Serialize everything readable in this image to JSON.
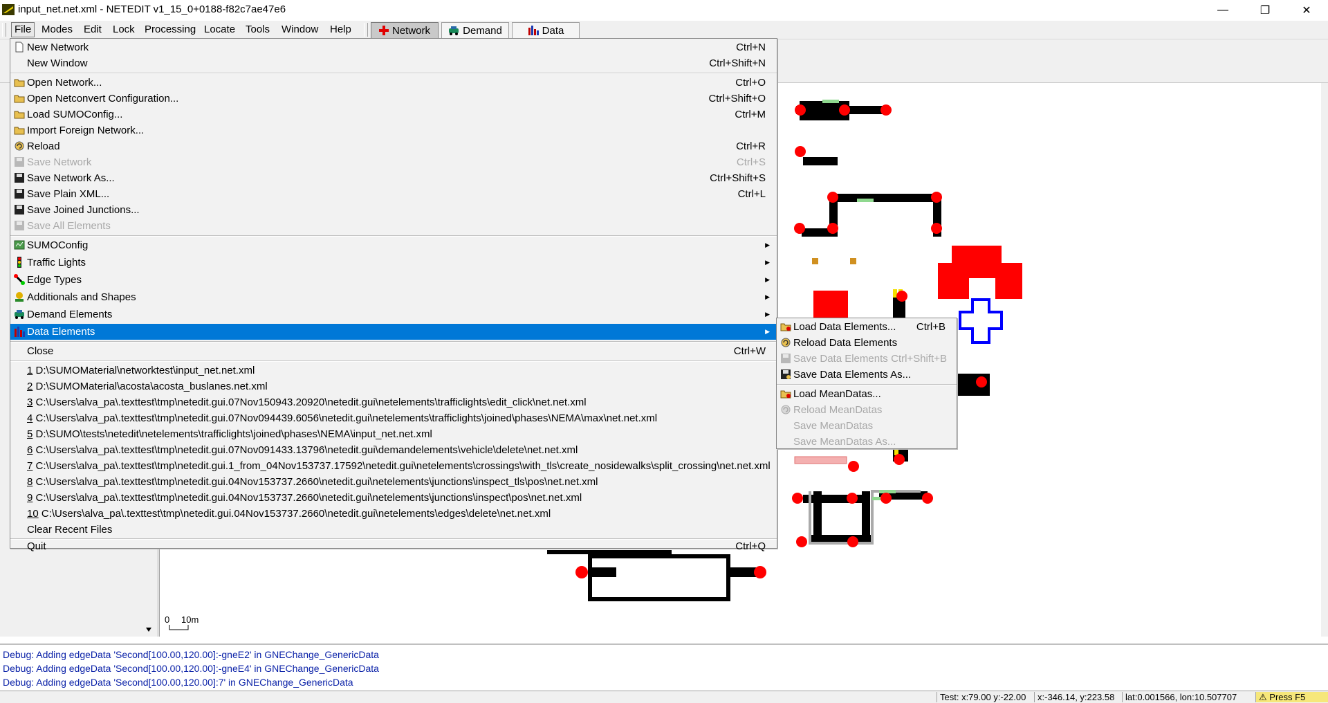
{
  "window": {
    "title": "input_net.net.xml - NETEDIT v1_15_0+0188-f82c7ae47e6",
    "minimize": "—",
    "restore": "❐",
    "close": "✕"
  },
  "menubar": {
    "items": [
      "File",
      "Modes",
      "Edit",
      "Lock",
      "Processing",
      "Locate",
      "Tools",
      "Window",
      "Help"
    ],
    "modes": [
      {
        "label": "Network",
        "icon": "network-cross-icon"
      },
      {
        "label": "Demand",
        "icon": "demand-car-icon"
      },
      {
        "label": "Data",
        "icon": "data-bars-icon"
      }
    ]
  },
  "file_menu": {
    "items": [
      {
        "label": "New Network",
        "shortcut": "Ctrl+N",
        "icon": "new-file-icon"
      },
      {
        "label": "New Window",
        "shortcut": "Ctrl+Shift+N",
        "icon": ""
      },
      {
        "label": "Open Network...",
        "shortcut": "Ctrl+O",
        "icon": "open-folder-icon"
      },
      {
        "label": "Open Netconvert Configuration...",
        "shortcut": "Ctrl+Shift+O",
        "icon": "open-folder-icon"
      },
      {
        "label": "Load SUMOConfig...",
        "shortcut": "Ctrl+M",
        "icon": "open-folder-icon"
      },
      {
        "label": "Import Foreign Network...",
        "shortcut": "",
        "icon": "open-folder-icon"
      },
      {
        "label": "Reload",
        "shortcut": "Ctrl+R",
        "icon": "reload-icon"
      },
      {
        "label": "Save Network",
        "shortcut": "Ctrl+S",
        "icon": "save-icon",
        "disabled": true
      },
      {
        "label": "Save Network As...",
        "shortcut": "Ctrl+Shift+S",
        "icon": "save-icon"
      },
      {
        "label": "Save Plain XML...",
        "shortcut": "Ctrl+L",
        "icon": "save-icon"
      },
      {
        "label": "Save Joined Junctions...",
        "shortcut": "",
        "icon": "save-icon"
      },
      {
        "label": "Save All Elements",
        "shortcut": "",
        "icon": "save-icon",
        "disabled": true
      },
      {
        "label": "SUMOConfig",
        "icon": "sumoconfig-icon",
        "submenu": true
      },
      {
        "label": "Traffic Lights",
        "icon": "traffic-light-icon",
        "submenu": true
      },
      {
        "label": "Edge Types",
        "icon": "edge-types-icon",
        "submenu": true
      },
      {
        "label": "Additionals and Shapes",
        "icon": "additionals-icon",
        "submenu": true
      },
      {
        "label": "Demand Elements",
        "icon": "demand-car-icon",
        "submenu": true
      },
      {
        "label": "Data Elements",
        "icon": "data-bars-icon",
        "submenu": true,
        "highlighted": true
      },
      {
        "label": "Close",
        "shortcut": "Ctrl+W",
        "icon": ""
      }
    ],
    "recent_files": [
      {
        "num": "1",
        "path": "D:\\SUMOMaterial\\networktest\\input_net.net.xml"
      },
      {
        "num": "2",
        "path": "D:\\SUMOMaterial\\acosta\\acosta_buslanes.net.xml"
      },
      {
        "num": "3",
        "path": "C:\\Users\\alva_pa\\.texttest\\tmp\\netedit.gui.07Nov150943.20920\\netedit.gui\\netelements\\trafficlights\\edit_click\\net.net.xml"
      },
      {
        "num": "4",
        "path": "C:\\Users\\alva_pa\\.texttest\\tmp\\netedit.gui.07Nov094439.6056\\netedit.gui\\netelements\\trafficlights\\joined\\phases\\NEMA\\max\\net.net.xml"
      },
      {
        "num": "5",
        "path": "D:\\SUMO\\tests\\netedit\\netelements\\trafficlights\\joined\\phases\\NEMA\\input_net.net.xml"
      },
      {
        "num": "6",
        "path": "C:\\Users\\alva_pa\\.texttest\\tmp\\netedit.gui.07Nov091433.13796\\netedit.gui\\demandelements\\vehicle\\delete\\net.net.xml"
      },
      {
        "num": "7",
        "path": "C:\\Users\\alva_pa\\.texttest\\tmp\\netedit.gui.1_from_04Nov153737.17592\\netedit.gui\\netelements\\crossings\\with_tls\\create_nosidewalks\\split_crossing\\net.net.xml"
      },
      {
        "num": "8",
        "path": "C:\\Users\\alva_pa\\.texttest\\tmp\\netedit.gui.04Nov153737.2660\\netedit.gui\\netelements\\junctions\\inspect_tls\\pos\\net.net.xml"
      },
      {
        "num": "9",
        "path": "C:\\Users\\alva_pa\\.texttest\\tmp\\netedit.gui.04Nov153737.2660\\netedit.gui\\netelements\\junctions\\inspect\\pos\\net.net.xml"
      },
      {
        "num": "10",
        "path": "C:\\Users\\alva_pa\\.texttest\\tmp\\netedit.gui.04Nov153737.2660\\netedit.gui\\netelements\\edges\\delete\\net.net.xml"
      }
    ],
    "clear_recent": "Clear Recent Files",
    "quit": {
      "label": "Quit",
      "shortcut": "Ctrl+Q"
    }
  },
  "data_submenu": {
    "items": [
      {
        "label": "Load Data Elements...",
        "shortcut": "Ctrl+B",
        "icon": "open-folder-icon"
      },
      {
        "label": "Reload Data Elements",
        "shortcut": "",
        "icon": "reload-icon"
      },
      {
        "label": "Save Data Elements",
        "shortcut": "Ctrl+Shift+B",
        "icon": "save-icon",
        "disabled": true
      },
      {
        "label": "Save Data Elements As...",
        "shortcut": "",
        "icon": "save-icon"
      },
      {
        "label": "Load MeanDatas...",
        "shortcut": "",
        "icon": "open-folder-icon"
      },
      {
        "label": "Reload MeanDatas",
        "shortcut": "",
        "icon": "reload-icon",
        "disabled": true
      },
      {
        "label": "Save MeanDatas",
        "shortcut": "",
        "icon": "",
        "disabled": true
      },
      {
        "label": "Save MeanDatas As...",
        "shortcut": "",
        "icon": "",
        "disabled": true
      }
    ]
  },
  "canvas": {
    "scale_label_0": "0",
    "scale_label_10": "10m"
  },
  "messages": [
    "Debug: Adding edgeData 'Second[100.00,120.00]:-gneE2' in GNEChange_GenericData",
    "Debug: Adding edgeData 'Second[100.00,120.00]:-gneE4' in GNEChange_GenericData",
    "Debug: Adding edgeData 'Second[100.00,120.00]:7' in GNEChange_GenericData"
  ],
  "status": {
    "test": "Test: x:79.00 y:-22.00",
    "xy": "x:-346.14, y:223.58",
    "latlon": "lat:0.001566, lon:10.507707",
    "badge": "Press F5"
  },
  "colors": {
    "highlight": "#0078d7",
    "junction": "#ff0000",
    "edge": "#000000",
    "selected_shape": "#0000ff",
    "debug_text": "#0b22a8"
  }
}
